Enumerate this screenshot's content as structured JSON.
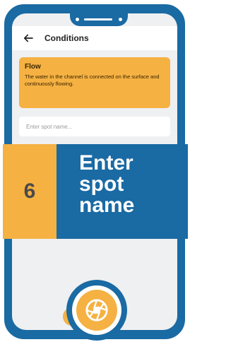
{
  "header": {
    "title": "Conditions",
    "back_icon": "arrow-left-icon"
  },
  "info_card": {
    "title": "Flow",
    "description": "The water in the channel is connected on the surface and continuously flowing."
  },
  "spot_name": {
    "placeholder": "Enter spot name...",
    "value": ""
  },
  "step": {
    "number": "6",
    "line1": "Enter",
    "line2": "spot",
    "line3": "name"
  },
  "camera_button": {
    "icon": "camera-shutter-icon"
  },
  "colors": {
    "primary": "#1a6aa3",
    "accent": "#f5b142",
    "background": "#eef0f2"
  }
}
